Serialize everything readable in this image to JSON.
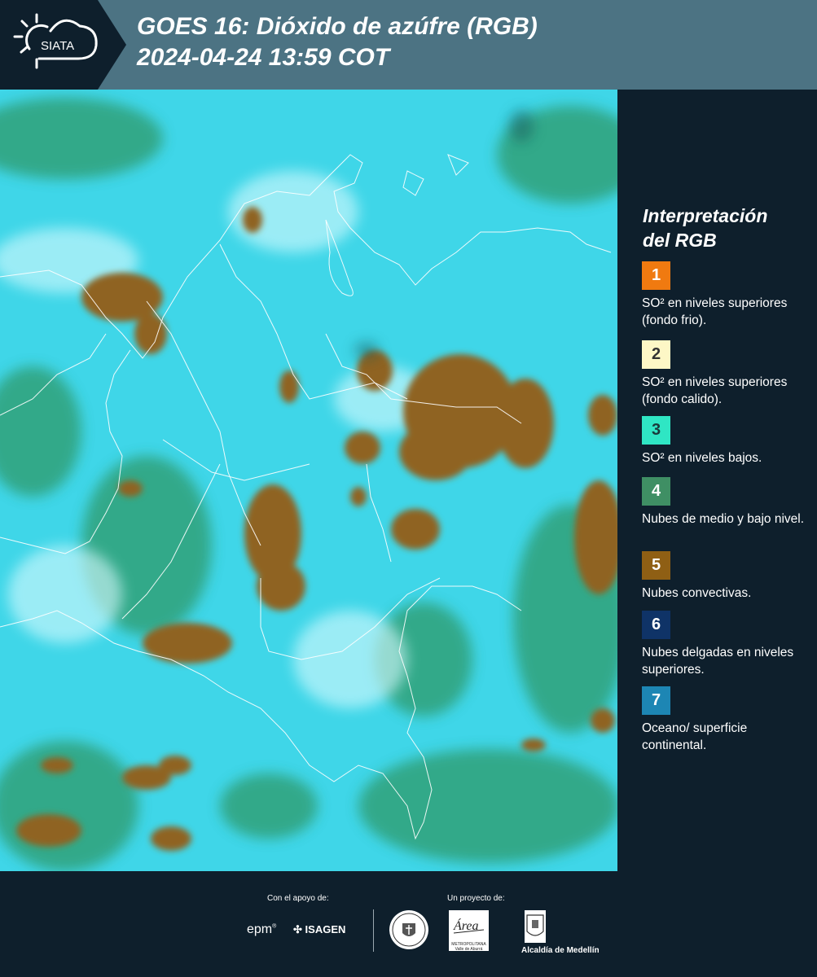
{
  "header": {
    "logo_text": "SIATA",
    "title_line1": "GOES 16: Dióxido de azúfre (RGB)",
    "title_line2": " 2024-04-24 13:59 COT"
  },
  "legend": {
    "title_line1": "Interpretación",
    "title_line2": "del RGB",
    "items": [
      {
        "num": "1",
        "color": "#f07a10",
        "text_color": "#ffffff",
        "label": "SO² en niveles superiores (fondo frio)."
      },
      {
        "num": "2",
        "color": "#fdf7c6",
        "text_color": "#333333",
        "label": "SO² en niveles superiores (fondo calido)."
      },
      {
        "num": "3",
        "color": "#2fe6c4",
        "text_color": "#1a3a3a",
        "label": "SO² en niveles bajos."
      },
      {
        "num": "4",
        "color": "#3f8f64",
        "text_color": "#ffffff",
        "label": "Nubes de medio y bajo nivel."
      },
      {
        "num": "5",
        "color": "#8f5f14",
        "text_color": "#ffffff",
        "label": "Nubes convectivas."
      },
      {
        "num": "6",
        "color": "#0f3367",
        "text_color": "#ffffff",
        "label": "Nubes delgadas en niveles superiores."
      },
      {
        "num": "7",
        "color": "#1d86b4",
        "text_color": "#ffffff",
        "label": "Oceano/ superficie continental."
      }
    ]
  },
  "footer": {
    "support_label": "Con el apoyo de:",
    "project_label": "Un proyecto de:",
    "epm": "epm",
    "isagen": "ISAGEN",
    "area_metro": "METROPOLITANA",
    "area_sub": "Valle de Aburrá",
    "alcaldia": "Alcaldía de Medellín"
  },
  "colors": {
    "header_bg": "#4c7383",
    "panel_bg": "#0e1f2c",
    "map_cyan": "#3fd6e8",
    "map_cloud": "#8f6420",
    "map_green": "#2f9a6a"
  }
}
